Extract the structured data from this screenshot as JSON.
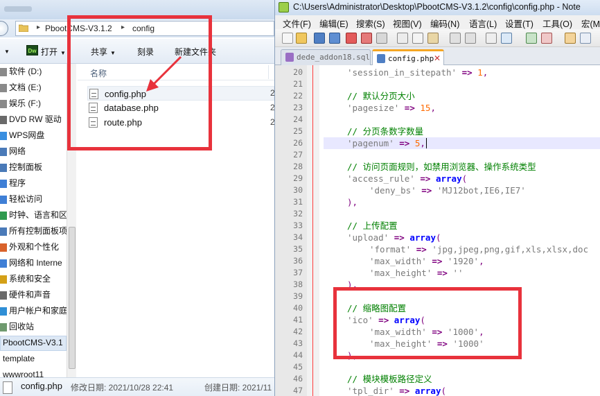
{
  "explorer": {
    "breadcrumbs": [
      "PbootCMS-V3.1.2",
      "config"
    ],
    "toolbar": {
      "open_label": "打开",
      "share_label": "共享",
      "burn_label": "刻录",
      "new_folder_label": "新建文件夹"
    },
    "nav_items": [
      {
        "label": "软件 (D:)",
        "icon": "drive-icon"
      },
      {
        "label": "文档 (E:)",
        "icon": "drive-icon"
      },
      {
        "label": "娱乐 (F:)",
        "icon": "drive-icon"
      },
      {
        "label": "DVD RW 驱动",
        "icon": "dvd-icon"
      },
      {
        "label": "WPS网盘",
        "icon": "cloud-icon"
      },
      {
        "label": "网络",
        "icon": "network-icon"
      },
      {
        "label": "控制面板",
        "icon": "control-panel-icon"
      },
      {
        "label": "程序",
        "icon": "programs-icon"
      },
      {
        "label": "轻松访问",
        "icon": "accessibility-icon"
      },
      {
        "label": "时钟、语言和区",
        "icon": "clock-icon"
      },
      {
        "label": "所有控制面板项",
        "icon": "panel-items-icon"
      },
      {
        "label": "外观和个性化",
        "icon": "appearance-icon"
      },
      {
        "label": "网络和 Interne",
        "icon": "network-internet-icon"
      },
      {
        "label": "系统和安全",
        "icon": "shield-icon"
      },
      {
        "label": "硬件和声音",
        "icon": "hardware-icon"
      },
      {
        "label": "用户帐户和家庭",
        "icon": "users-icon"
      },
      {
        "label": "回收站",
        "icon": "recycle-bin-icon"
      },
      {
        "label": "PbootCMS-V3.1",
        "icon": "folder-icon"
      },
      {
        "label": "template",
        "icon": "folder-icon"
      },
      {
        "label": "wwwroot11",
        "icon": "folder-icon"
      }
    ],
    "column_name": "名称",
    "files": [
      {
        "name": "config.php",
        "date_cut": "2"
      },
      {
        "name": "database.php",
        "date_cut": "2"
      },
      {
        "name": "route.php",
        "date_cut": "2"
      }
    ],
    "details": {
      "file_name": "config.php",
      "modified": "修改日期: 2021/10/28 22:41",
      "created": "创建日期: 2021/11"
    }
  },
  "notepad": {
    "title": "C:\\Users\\Administrator\\Desktop\\PbootCMS-V3.1.2\\config\\config.php - Note",
    "menu": [
      "文件(F)",
      "编辑(E)",
      "搜索(S)",
      "视图(V)",
      "编码(N)",
      "语言(L)",
      "设置(T)",
      "工具(O)",
      "宏(M"
    ],
    "tabs": [
      {
        "label": "dede_addon18.sql",
        "active": false
      },
      {
        "label": "config.php",
        "active": true
      }
    ],
    "line_numbers": [
      "20",
      "21",
      "22",
      "23",
      "24",
      "25",
      "26",
      "27",
      "28",
      "29",
      "30",
      "31",
      "32",
      "33",
      "34",
      "35",
      "36",
      "37",
      "38",
      "39",
      "40",
      "41",
      "42",
      "43",
      "44",
      "45",
      "46",
      "47"
    ],
    "code": {
      "l20_key": "'session_in_sitepath'",
      "l20_val": "1",
      "l22": "// 默认分页大小",
      "l23_key": "'pagesize'",
      "l23_val": "15",
      "l25": "// 分页条数字数量",
      "l26_key": "'pagenum'",
      "l26_val": "5",
      "l28": "// 访问页面规则，如禁用浏览器、操作系统类型",
      "l29_key": "'access_rule'",
      "l30_key": "'deny_bs'",
      "l30_val": "'MJ12bot,IE6,IE7'",
      "l31": "),",
      "l33": "// 上传配置",
      "l34_key": "'upload'",
      "l35_key": "'format'",
      "l35_val": "'jpg,jpeg,png,gif,xls,xlsx,doc",
      "l36_key": "'max_width'",
      "l36_val": "'1920'",
      "l37_key": "'max_height'",
      "l37_val": "''",
      "l38": "),",
      "l40": "// 缩略图配置",
      "l41_key": "'ico'",
      "l42_key": "'max_width'",
      "l42_val": "'1000'",
      "l43_key": "'max_height'",
      "l43_val": "'1000'",
      "l44": "),",
      "l46": "// 模块模板路径定义",
      "l47_key": "'tpl_dir'",
      "arrow": "=>",
      "array_kw": "array",
      "paren_open": "(",
      "comma": ","
    }
  },
  "colors": {
    "annotation_red": "#e8323c",
    "comment_green": "#008000",
    "keyword_blue": "#0000ff",
    "number_orange": "#ff6a00",
    "operator_purple": "#7f007f"
  }
}
